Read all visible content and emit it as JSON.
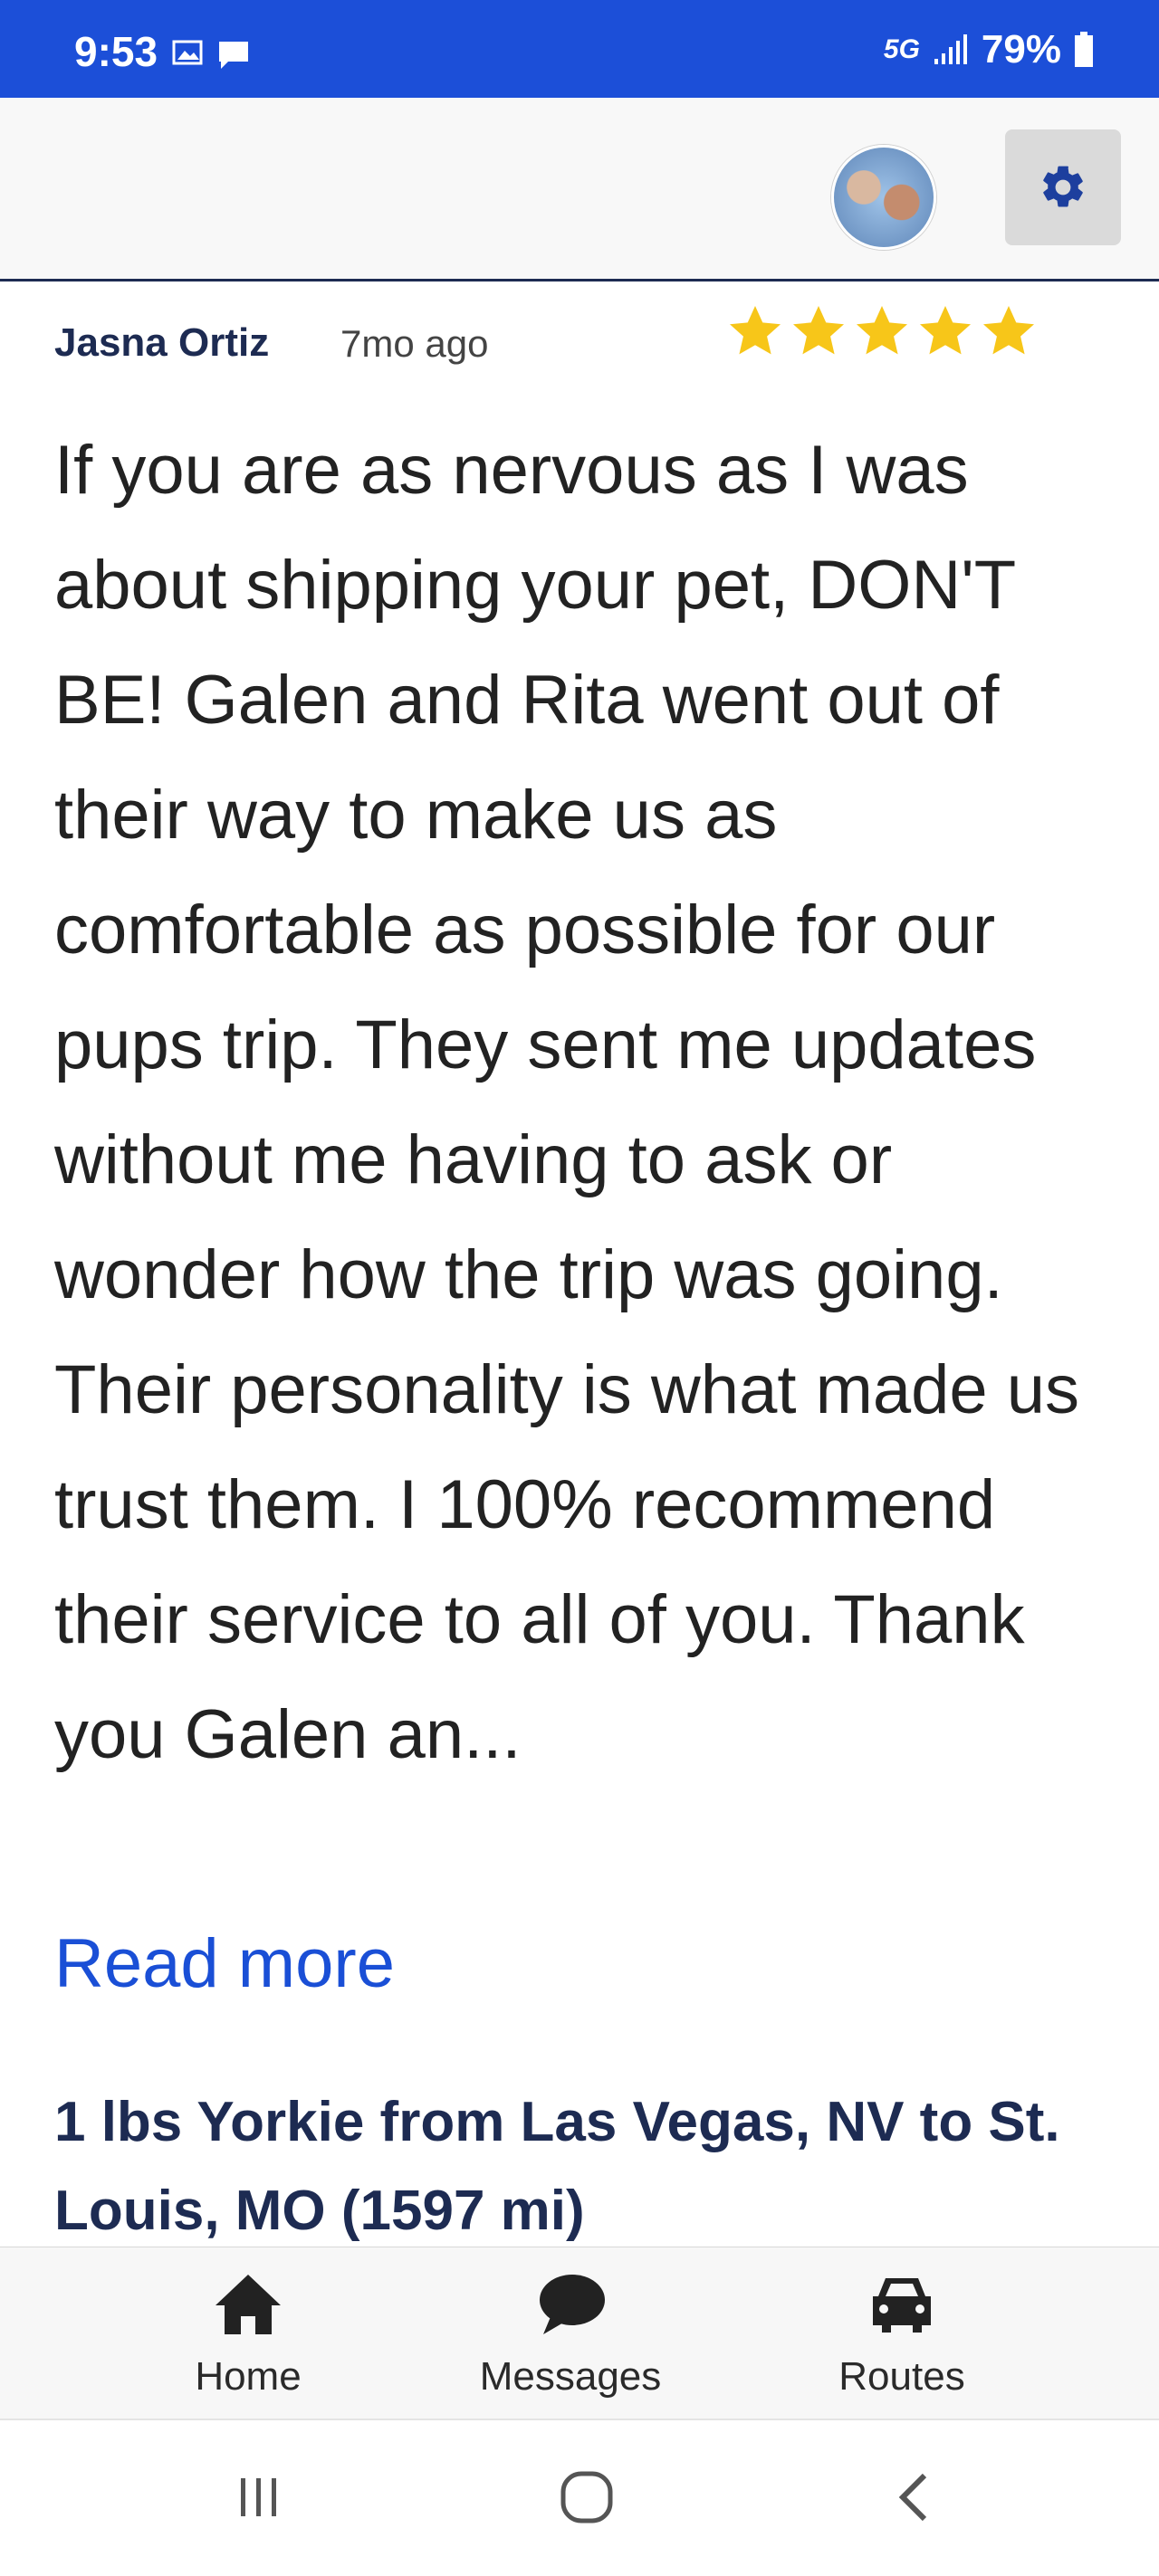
{
  "status_bar": {
    "time": "9:53",
    "network": "5G",
    "battery": "79%"
  },
  "header": {
    "avatar_icon": "user-avatar",
    "settings_icon": "gear-icon"
  },
  "review": {
    "reviewer": "Jasna Ortiz",
    "time_ago": "7mo ago",
    "rating": 5,
    "rating_max": 5,
    "star_color": "#f7c619",
    "text": "If you are as nervous as I was about shipping your pet, DON'T BE! Galen and Rita went out of their way to make us as comfortable as possible for our pups trip. They sent me updates without me having to ask or wonder how the trip was going. Their personality is what made us trust them. I 100% recommend their service to all of you. Thank you Galen an...",
    "read_more": "Read more",
    "route": "1 lbs Yorkie from Las Vegas, NV to St. Louis, MO (1597 mi)"
  },
  "bottom_nav": {
    "items": [
      {
        "label": "Home",
        "icon": "home-icon"
      },
      {
        "label": "Messages",
        "icon": "chat-bubble-icon"
      },
      {
        "label": "Routes",
        "icon": "car-icon"
      }
    ]
  },
  "system_nav": {
    "icons": [
      "recents-icon",
      "home-circle-icon",
      "back-icon"
    ]
  },
  "colors": {
    "status_bar": "#1c4fd8",
    "link": "#1a4fd6",
    "heading": "#1d2b52"
  }
}
